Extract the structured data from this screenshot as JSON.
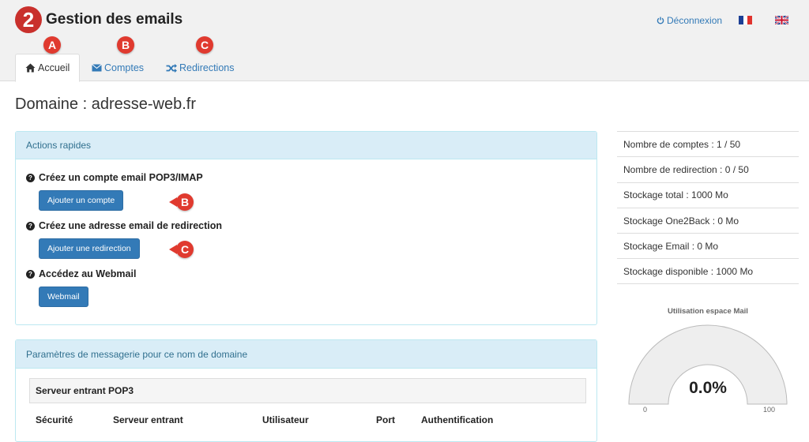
{
  "header": {
    "logo_glyph": "2",
    "title": "Gestion des emails",
    "logout_label": "Déconnexion",
    "languages": [
      "fr",
      "en"
    ]
  },
  "tabs": [
    {
      "label": "Accueil",
      "icon": "home-icon",
      "active": true,
      "marker": "A"
    },
    {
      "label": "Comptes",
      "icon": "envelope-icon",
      "active": false,
      "marker": "B"
    },
    {
      "label": "Redirections",
      "icon": "shuffle-icon",
      "active": false,
      "marker": "C"
    }
  ],
  "domain_title": "Domaine : adresse-web.fr",
  "quick_actions": {
    "heading": "Actions rapides",
    "items": [
      {
        "title": "Créez un compte email POP3/IMAP",
        "button": "Ajouter un compte",
        "marker": "B"
      },
      {
        "title": "Créez une adresse email de redirection",
        "button": "Ajouter une redirection",
        "marker": "C"
      },
      {
        "title": "Accédez au Webmail",
        "button": "Webmail"
      }
    ]
  },
  "settings": {
    "heading": "Paramètres de messagerie pour ce nom de domaine",
    "incoming_heading": "Serveur entrant POP3",
    "columns": [
      "Sécurité",
      "Serveur entrant",
      "Utilisateur",
      "Port",
      "Authentification"
    ]
  },
  "stats": [
    "Nombre de comptes : 1 / 50",
    "Nombre de redirection : 0 / 50",
    "Stockage total : 1000 Mo",
    "Stockage One2Back : 0 Mo",
    "Stockage Email : 0 Mo",
    "Stockage disponible : 1000 Mo"
  ],
  "gauge": {
    "title": "Utilisation espace Mail",
    "value": 0,
    "value_label": "0.0%",
    "min": "0",
    "max": "100"
  },
  "colors": {
    "accent": "#337ab7",
    "marker": "#e03a2f",
    "panel_heading": "#d9edf7"
  }
}
